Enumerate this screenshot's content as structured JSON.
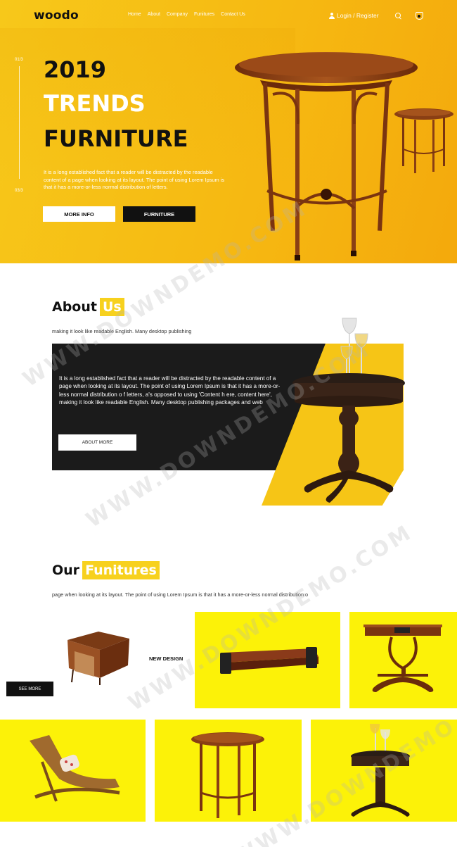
{
  "header": {
    "logo": "woodo",
    "nav": [
      "Home",
      "About",
      "Company",
      "Funitures",
      "Contact Us"
    ],
    "login": "Login / Register",
    "icons": [
      "user-icon",
      "search-icon",
      "cart-icon"
    ]
  },
  "hero": {
    "slide_top": "01/3",
    "slide_bottom": "03/3",
    "title_line1": "2019",
    "title_line2": "TRENDS",
    "title_line3": "FURNITURE",
    "description": "It is a long established fact that a reader will be distracted by the readable content of a page when looking at its layout. The point of using Lorem Ipsum is that it has a more-or-less normal distribution of letters.",
    "btn_more": "MORE INFO",
    "btn_furniture": "FURNITURE"
  },
  "about": {
    "title": "About",
    "title_highlight": "Us",
    "subtitle": "making it look like readable English. Many desktop publishing",
    "text": "It is a long established fact that a reader will be distracted by the readable content of a page when looking at its layout. The point of using Lorem Ipsum is that it has a more-or-less normal distribution o f letters, a's opposed to using 'Content h ere, content here', making it look like readable English. Many desktop publishing packages and web",
    "button": "ABOUT MORE"
  },
  "furnitures": {
    "title": "Our",
    "title_highlight": "Funitures",
    "subtitle": "page when looking at its layout. The point of using Lorem Ipsum is that it has a more-or-less normal distribution o",
    "new_design": "NEW DESIGN",
    "see_more": "SEE MORE"
  },
  "watermark": "WWW.DOWNDEMO.COM",
  "colors": {
    "hero_yellow": "#f7c81a",
    "accent_yellow": "#f7d11e",
    "tile_yellow": "#fcf208",
    "dark": "#1b1b1b",
    "wood": "#8a3f14"
  }
}
